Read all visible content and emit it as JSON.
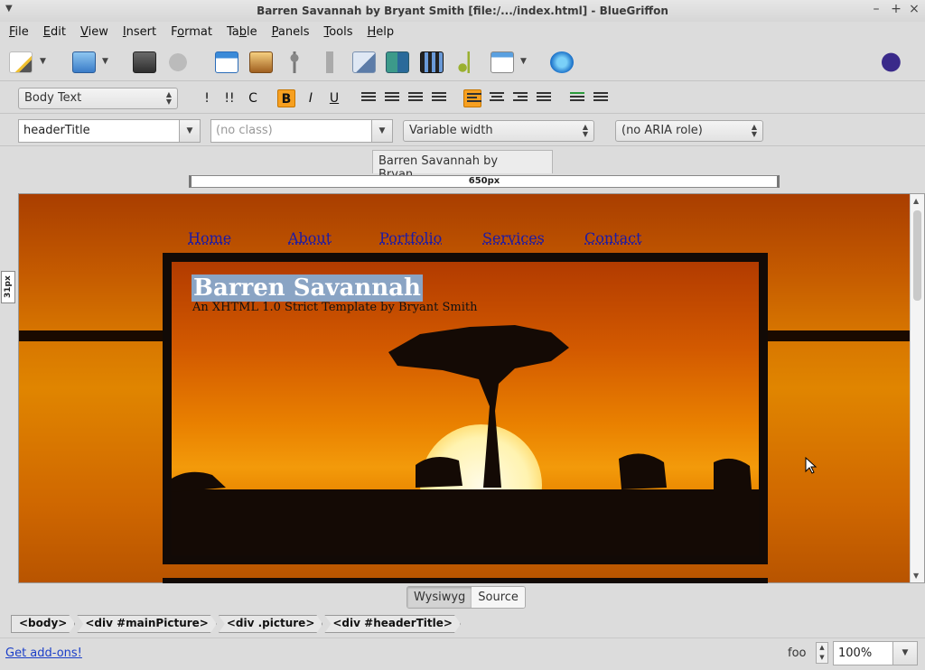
{
  "window": {
    "title": "Barren Savannah by Bryant Smith [file:/.../index.html] - BlueGriffon"
  },
  "menu": {
    "items": [
      {
        "label": "File",
        "accel": "F",
        "rest": "ile"
      },
      {
        "label": "Edit",
        "accel": "E",
        "rest": "dit"
      },
      {
        "label": "View",
        "accel": "V",
        "rest": "iew"
      },
      {
        "label": "Insert",
        "accel": "I",
        "rest": "nsert"
      },
      {
        "label": "Format",
        "pre": "F",
        "accel": "o",
        "rest": "rmat"
      },
      {
        "label": "Table",
        "pre": "Ta",
        "accel": "b",
        "rest": "le"
      },
      {
        "label": "Panels",
        "accel": "P",
        "rest": "anels"
      },
      {
        "label": "Tools",
        "accel": "T",
        "rest": "ools"
      },
      {
        "label": "Help",
        "accel": "H",
        "rest": "elp"
      }
    ]
  },
  "format": {
    "paragraph": "Body Text",
    "bold": "B",
    "italic": "I",
    "underline": "U",
    "strong": "!",
    "em": "!!",
    "code": "C"
  },
  "idbar": {
    "id_value": "headerTitle",
    "class_placeholder": "(no class)",
    "width_mode": "Variable width",
    "aria_role": "(no ARIA role)"
  },
  "doc_tab": "Barren Savannah by Bryan...",
  "ruler": {
    "width_label": "650px",
    "side_label": "31px"
  },
  "page": {
    "nav": [
      "Home",
      "About",
      "Portfolio",
      "Services",
      "Contact"
    ],
    "header_title": "Barren Savannah",
    "header_subtitle": "An XHTML 1.0 Strict Template by Bryant Smith"
  },
  "view": {
    "wysiwyg": "Wysiwyg",
    "source": "Source"
  },
  "path": [
    "<body>",
    "<div #mainPicture>",
    "<div .picture>",
    "<div #headerTitle>"
  ],
  "status": {
    "addons": "Get add-ons!",
    "label": "foo",
    "zoom": "100%"
  },
  "colors": {
    "accent": "#f7a020",
    "sky": "#d67400",
    "link": "#1a1aa8"
  }
}
